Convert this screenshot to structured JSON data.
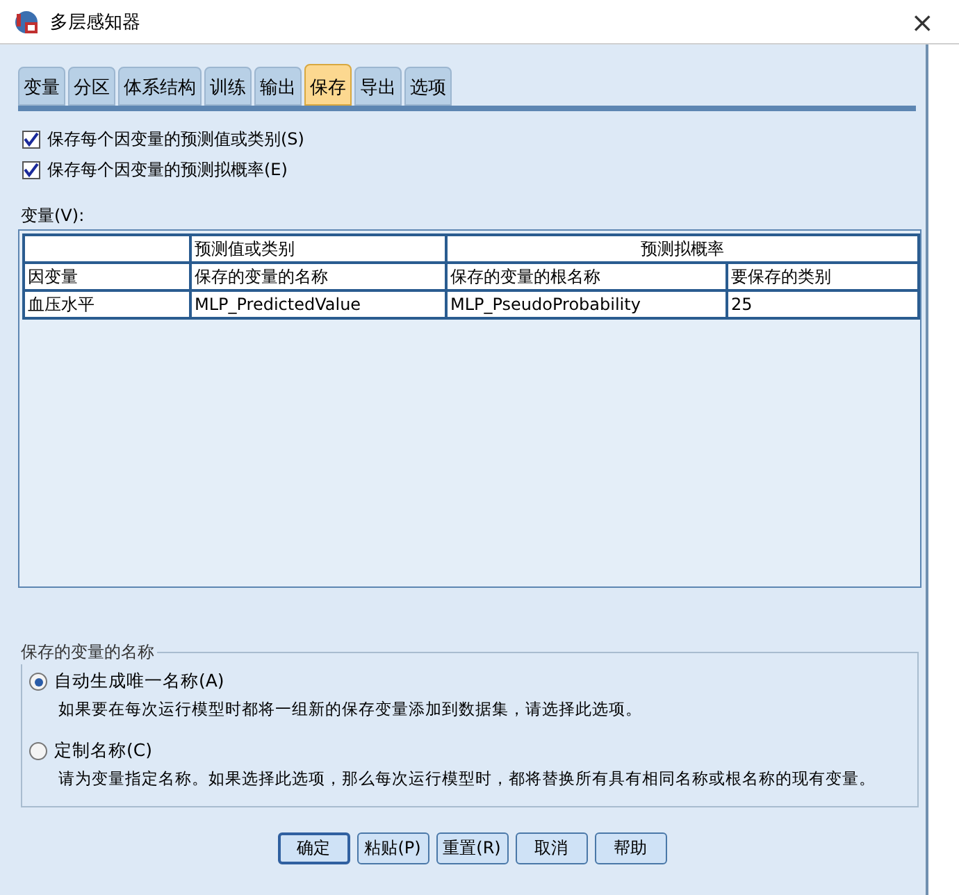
{
  "window": {
    "title": "多层感知器",
    "close": "×"
  },
  "tabs": [
    {
      "label": "变量",
      "selected": false
    },
    {
      "label": "分区",
      "selected": false
    },
    {
      "label": "体系结构",
      "selected": false
    },
    {
      "label": "训练",
      "selected": false
    },
    {
      "label": "输出",
      "selected": false
    },
    {
      "label": "保存",
      "selected": true
    },
    {
      "label": "导出",
      "selected": false
    },
    {
      "label": "选项",
      "selected": false
    }
  ],
  "checkboxes": [
    {
      "label": "保存每个因变量的预测值或类别(S)",
      "checked": true
    },
    {
      "label": "保存每个因变量的预测拟概率(E)",
      "checked": true
    }
  ],
  "table": {
    "label": "变量(V):",
    "group_headers": [
      "预测值或类别",
      "预测拟概率"
    ],
    "columns": [
      "因变量",
      "保存的变量的名称",
      "保存的变量的根名称",
      "要保存的类别"
    ],
    "rows": [
      [
        "血压水平",
        "MLP_PredictedValue",
        "MLP_PseudoProbability",
        "25"
      ]
    ]
  },
  "naming": {
    "title": "保存的变量的名称",
    "options": [
      {
        "label": "自动生成唯一名称(A)",
        "description": "如果要在每次运行模型时都将一组新的保存变量添加到数据集，请选择此选项。",
        "selected": true
      },
      {
        "label": "定制名称(C)",
        "description": "请为变量指定名称。如果选择此选项，那么每次运行模型时，都将替换所有具有相同名称或根名称的现有变量。",
        "selected": false
      }
    ]
  },
  "buttons": [
    "确定",
    "粘贴(P)",
    "重置(R)",
    "取消",
    "帮助"
  ]
}
